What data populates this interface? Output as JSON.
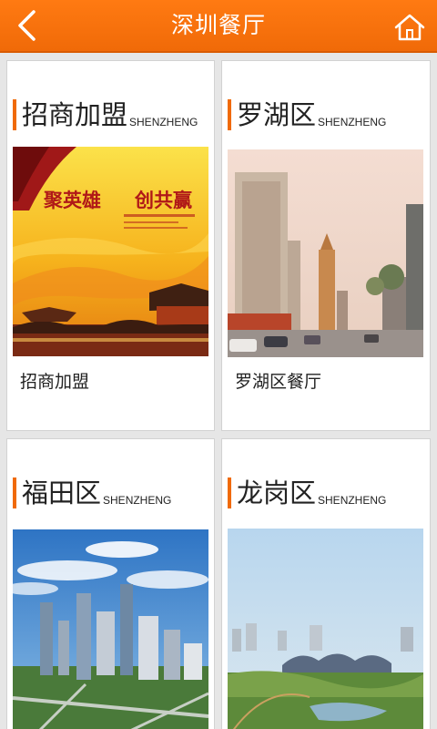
{
  "header": {
    "title": "深圳餐厅",
    "back_icon": "back-arrow-icon",
    "home_icon": "home-icon"
  },
  "cards": [
    {
      "name": "招商加盟",
      "sub": "SHENZHENG",
      "caption": "招商加盟",
      "banner_text_1": "聚英雄",
      "banner_text_2": "创共赢"
    },
    {
      "name": "罗湖区",
      "sub": "SHENZHENG",
      "caption": "罗湖区餐厅"
    },
    {
      "name": "福田区",
      "sub": "SHENZHENG",
      "caption": ""
    },
    {
      "name": "龙岗区",
      "sub": "SHENZHENG",
      "caption": ""
    }
  ],
  "colors": {
    "accent": "#f06a08",
    "header": "#ff7a12"
  }
}
